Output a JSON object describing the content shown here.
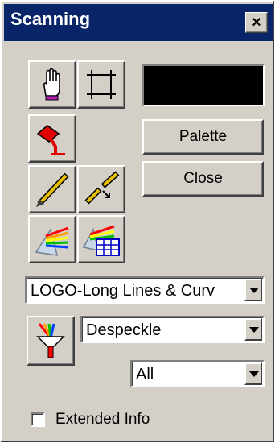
{
  "window": {
    "title": "Scanning",
    "close_glyph": "×"
  },
  "tools": [
    {
      "name": "hand-icon"
    },
    {
      "name": "crop-frame-icon"
    },
    {
      "name": "paint-pour-icon"
    },
    {
      "name": "pen-icon"
    },
    {
      "name": "pen-arrow-icon"
    },
    {
      "name": "prism-icon"
    },
    {
      "name": "prism-table-icon"
    }
  ],
  "swatch": {
    "color": "#000000"
  },
  "buttons": {
    "palette": "Palette",
    "close": "Close"
  },
  "dropdowns": {
    "mode": {
      "value": "LOGO-Long Lines & Curv"
    },
    "filter": {
      "value": "Despeckle"
    },
    "scope": {
      "value": "All"
    }
  },
  "filter_tool": {
    "name": "funnel-filter-icon"
  },
  "checkbox": {
    "label": "Extended Info",
    "checked": false
  },
  "colors": {
    "titlebar": "#0a246a",
    "face": "#d4d0c8"
  }
}
